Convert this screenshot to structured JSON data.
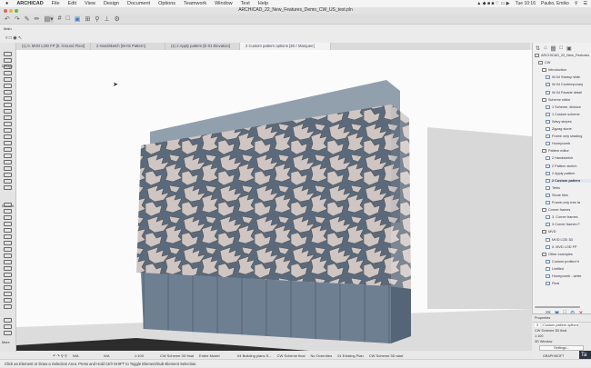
{
  "menubar": {
    "app": "ARCHICAD",
    "items": [
      "File",
      "Edit",
      "View",
      "Design",
      "Document",
      "Options",
      "Teamwork",
      "Window",
      "Test",
      "Help"
    ],
    "clock": "Tue 10:16",
    "user": "Pauko, Emiko"
  },
  "window": {
    "title": "ARCHICAD_22_New_Features_Demo_CW_US_test.pln"
  },
  "infobox": {
    "label": "Main"
  },
  "toolbox": {
    "design_label": "Design",
    "document_label": "Documt",
    "more_label": "More"
  },
  "tabs": [
    {
      "label": "(1) 0. MVD LOD FP [0. Ground Floor]"
    },
    {
      "label": "2 Handsketch [W-02 Pattern]"
    },
    {
      "label": "(1) 2 Apply pattern [E-01 Elevation]"
    },
    {
      "label": "2 Custom pattern options [3D / Marquee]"
    }
  ],
  "navigator": {
    "items": [
      {
        "label": "ARCHICAD_22_New_Features",
        "level": 0,
        "type": "root"
      },
      {
        "label": "CW",
        "level": 1,
        "type": "folder"
      },
      {
        "label": "Introduction",
        "level": 2,
        "type": "folder"
      },
      {
        "label": "W-04 Startup slide",
        "level": 3,
        "type": "view"
      },
      {
        "label": "W-04 Contemporary",
        "level": 3,
        "type": "view"
      },
      {
        "label": "W-04 Facade detail",
        "level": 3,
        "type": "view"
      },
      {
        "label": "Scheme editor",
        "level": 2,
        "type": "folder"
      },
      {
        "label": "1 Scheme, division",
        "level": 3,
        "type": "view"
      },
      {
        "label": "1 Custom scheme",
        "level": 3,
        "type": "view"
      },
      {
        "label": "Wavy stripes",
        "level": 3,
        "type": "view"
      },
      {
        "label": "Zigzag stone",
        "level": 3,
        "type": "view"
      },
      {
        "label": "Frame only shading",
        "level": 3,
        "type": "view"
      },
      {
        "label": "Honeycomb",
        "level": 3,
        "type": "view"
      },
      {
        "label": "Pattern editor",
        "level": 2,
        "type": "folder"
      },
      {
        "label": "2 Handsketch",
        "level": 3,
        "type": "view"
      },
      {
        "label": "2 Pattern sketch",
        "level": 3,
        "type": "view"
      },
      {
        "label": "2 Apply pattern",
        "level": 3,
        "type": "view"
      },
      {
        "label": "2 Custom pattern",
        "level": 3,
        "type": "view",
        "selected": true
      },
      {
        "label": "Tetris",
        "level": 3,
        "type": "view"
      },
      {
        "label": "Stone tiles",
        "level": 3,
        "type": "view"
      },
      {
        "label": "Frame-only tree fa",
        "level": 3,
        "type": "view"
      },
      {
        "label": "Corner frames",
        "level": 2,
        "type": "folder"
      },
      {
        "label": "3. Corner frames",
        "level": 3,
        "type": "view"
      },
      {
        "label": "3 Corner frames F",
        "level": 3,
        "type": "view"
      },
      {
        "label": "MVD",
        "level": 2,
        "type": "folder"
      },
      {
        "label": "MVD LOD 3D",
        "level": 3,
        "type": "view"
      },
      {
        "label": "0. MVD LOD FP",
        "level": 3,
        "type": "view"
      },
      {
        "label": "Other examples",
        "level": 2,
        "type": "folder"
      },
      {
        "label": "Custom profiled fr",
        "level": 3,
        "type": "view"
      },
      {
        "label": "Untitled",
        "level": 3,
        "type": "view"
      },
      {
        "label": "Honeycomb - white",
        "level": 3,
        "type": "view"
      },
      {
        "label": "Final",
        "level": 3,
        "type": "view"
      }
    ]
  },
  "properties": {
    "header": "Properties",
    "id": "3",
    "name": "Custom pattern options",
    "layer": "CW Scheme 3D final",
    "scale": "1:100",
    "type": "3D Window",
    "settings_button": "Settings...",
    "graphisoft": "GRAPHISOFT",
    "tab_label": "Ta"
  },
  "statusbar": {
    "na1": "N/A",
    "na2": "N/A",
    "scale": "1:100",
    "layer_combo": "CW Scheme 3D final",
    "model": "Entire Model",
    "pen_set": "04 Building plans S...",
    "mvo": "CW Scheme final",
    "overrides": "No Overrides",
    "renovation": "01 Existing Plan",
    "dimension": "CW Scheme 3D start"
  },
  "message": "Click an Element or Draw a Selection Area. Press and Hold Ctrl+SHIFT to Toggle Element/Sub-Element Selection.",
  "colors": {
    "glass": "#7f8fa0",
    "leaf": "#cfc6c4",
    "panel_bg": "#f0f0f0",
    "selected": "#dfe6f0"
  }
}
